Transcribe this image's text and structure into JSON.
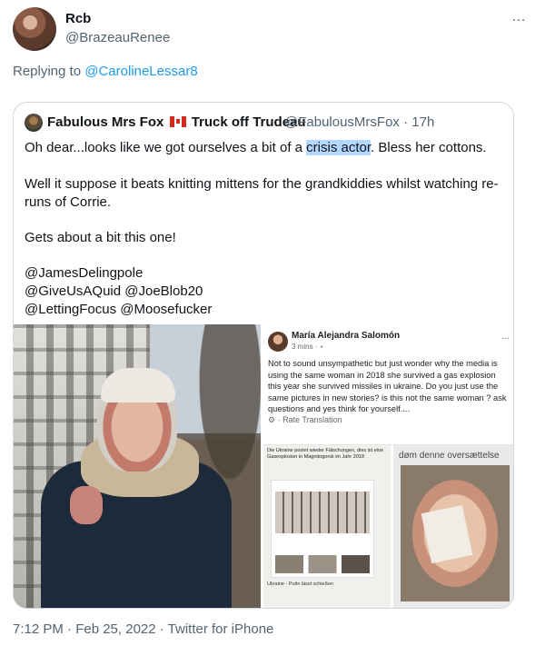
{
  "tweet": {
    "display_name": "Rcb",
    "handle": "@BrazeauRenee",
    "more_icon": "…",
    "replying_prefix": "Replying to",
    "replying_to": "@CarolineLessar8",
    "timestamp": "7:12 PM · Feb 25, 2022 · Twitter for iPhone"
  },
  "quote": {
    "name_part1": "Fabulous Mrs Fox",
    "name_part2": "Truck off Trudeau",
    "flag_icon": "canada-flag-icon",
    "meta": "@FabulousMrsFox · 17h",
    "line1_before": "Oh dear...looks like we got ourselves a bit of a ",
    "line1_highlight": "crisis actor",
    "line1_after": ". Bless her cottons.",
    "para2": "Well it suppose it beats knitting mittens for the grandkiddies whilst watching re-runs of Corrie.",
    "para3": "Gets about a bit this one!",
    "mentions1": "@JamesDelingpole",
    "mentions2": "@GiveUsAQuid @JoeBlob20",
    "mentions3": "@LettingFocus @Moosefucker"
  },
  "embedded_post": {
    "name": "María Alejandra Salomón",
    "time": "3 mins · ⋆",
    "dots": "...",
    "text": "Not to sound unsympathetic but just wonder why the media is using the same woman in 2018 she survived a gas explosion this year she survived missiles in ukraine. Do you just use the same pictures in new stories? is this not the same woman ? ask questions and yes think for yourself....",
    "translate": "⚙ · Rate Translation",
    "screenshot_title": "Die Ukraine postet wieder Fälschungen, dies ist eine Gasexplosion in Magnitogorsk im Jahr 2018",
    "screenshot_caption": "Ukraine - Putin lässt schießen",
    "translate_label": "døm denne oversættelse"
  }
}
